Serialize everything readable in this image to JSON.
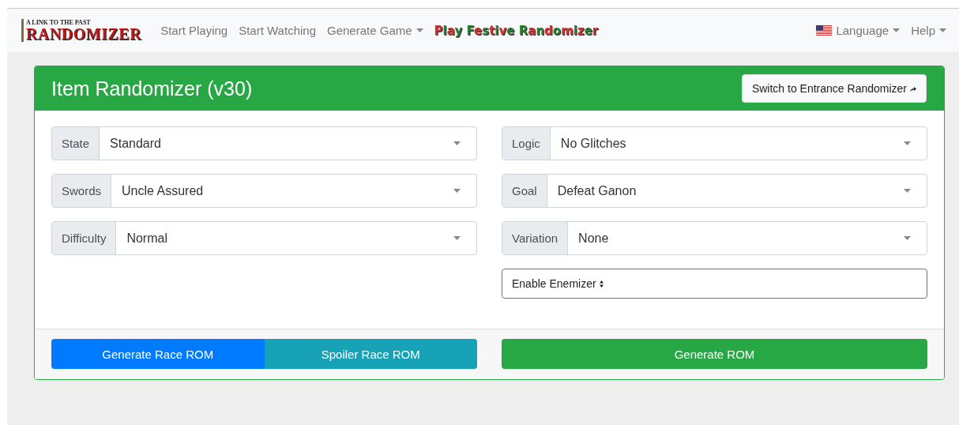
{
  "navbar": {
    "logo": {
      "top_line": "A LINK TO THE PAST",
      "main": "RANDOMIZER"
    },
    "links": [
      {
        "label": "Start Playing",
        "dropdown": false
      },
      {
        "label": "Start Watching",
        "dropdown": false
      },
      {
        "label": "Generate Game",
        "dropdown": true
      }
    ],
    "festive_link": "Play Festive Randomizer",
    "right_links": [
      {
        "label": "Language",
        "dropdown": true,
        "flag": true
      },
      {
        "label": "Help",
        "dropdown": true,
        "flag": false
      }
    ]
  },
  "card": {
    "title": "Item Randomizer (v30)",
    "switch_button": "Switch to Entrance Randomizer",
    "left_selects": [
      {
        "label": "State",
        "value": "Standard"
      },
      {
        "label": "Swords",
        "value": "Uncle Assured"
      },
      {
        "label": "Difficulty",
        "value": "Normal"
      }
    ],
    "right_selects": [
      {
        "label": "Logic",
        "value": "No Glitches"
      },
      {
        "label": "Goal",
        "value": "Defeat Ganon"
      },
      {
        "label": "Variation",
        "value": "None"
      }
    ],
    "enemizer_button": "Enable Enemizer",
    "footer": {
      "race_button": "Generate Race ROM",
      "spoiler_button": "Spoiler Race ROM",
      "generate_button": "Generate ROM"
    }
  }
}
